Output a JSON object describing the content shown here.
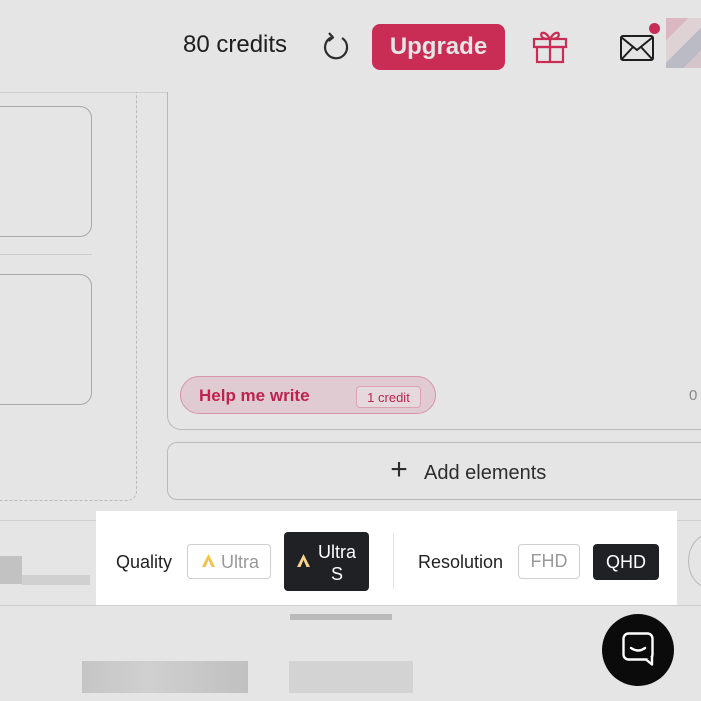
{
  "header": {
    "credits_label": "80 credits",
    "upgrade_label": "Upgrade",
    "refresh_icon": "refresh-icon",
    "gift_icon": "gift-icon",
    "mail_icon": "mail-icon",
    "accent_color": "#e0335f"
  },
  "editor": {
    "help_label": "Help me write",
    "help_cost": "1 credit",
    "char_count": "0"
  },
  "add_elements": {
    "label": "Add elements",
    "icon": "plus-icon"
  },
  "settings": {
    "quality_label": "Quality",
    "quality_options": [
      {
        "label": "Ultra",
        "selected": false,
        "icon": "ultra-icon"
      },
      {
        "label": "Ultra S",
        "selected": true,
        "icon": "ultra-icon"
      }
    ],
    "resolution_label": "Resolution",
    "resolution_options": [
      {
        "label": "FHD",
        "selected": false
      },
      {
        "label": "QHD",
        "selected": true
      }
    ]
  },
  "chat": {
    "icon": "chat-icon"
  }
}
